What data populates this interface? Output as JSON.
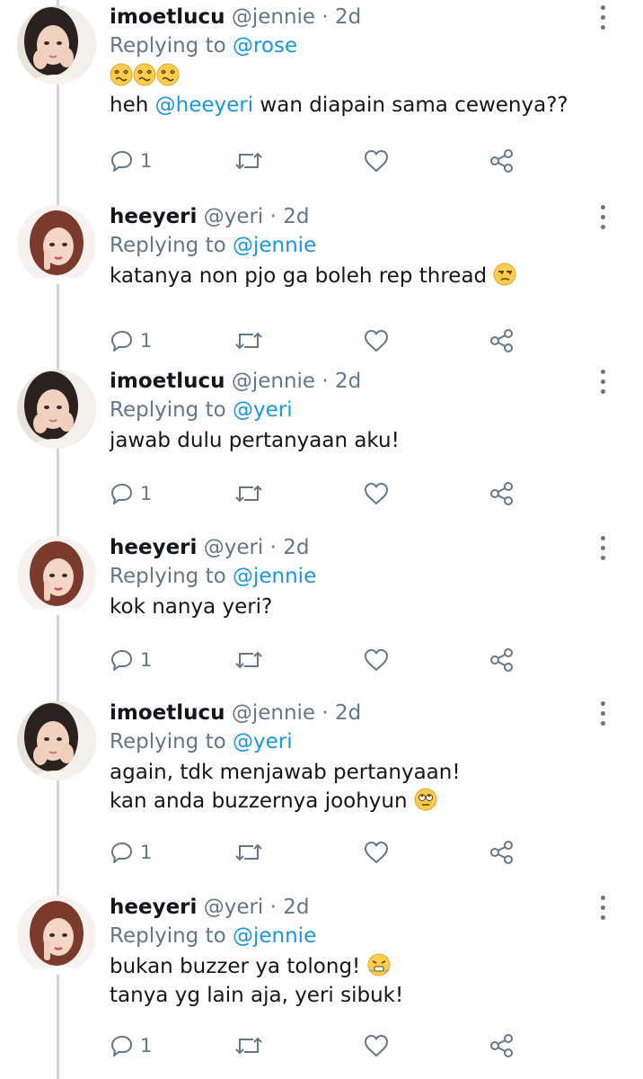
{
  "colors": {
    "mention": "#1b95e0",
    "secondary_text": "#657786",
    "thread_line": "#ccd6dd"
  },
  "tweets": [
    {
      "display_name": "imoetlucu",
      "handle": "@jennie",
      "separator": "·",
      "time": "2d",
      "replying_label": "Replying to",
      "replying_to": "@rose",
      "body": [
        {
          "emoji_only": [
            "woozy-face-emoji",
            "woozy-face-emoji",
            "woozy-face-emoji"
          ]
        },
        {
          "prefix": "heh ",
          "mention": "@heeyeri",
          "suffix": " wan diapain sama cewenya??"
        }
      ],
      "reply_count": "1",
      "avatar": "avatar-jennie"
    },
    {
      "display_name": "heeyeri",
      "handle": "@yeri",
      "separator": "·",
      "time": "2d",
      "replying_label": "Replying to",
      "replying_to": "@jennie",
      "body": [
        {
          "prefix": "katanya non pjo ga boleh rep thread ",
          "emoji": "unamused-face-emoji"
        }
      ],
      "reply_count": "1",
      "avatar": "avatar-yeri"
    },
    {
      "display_name": "imoetlucu",
      "handle": "@jennie",
      "separator": "·",
      "time": "2d",
      "replying_label": "Replying to",
      "replying_to": "@yeri",
      "body": [
        {
          "prefix": "jawab dulu pertanyaan aku!"
        }
      ],
      "reply_count": "1",
      "avatar": "avatar-jennie"
    },
    {
      "display_name": "heeyeri",
      "handle": "@yeri",
      "separator": "·",
      "time": "2d",
      "replying_label": "Replying to",
      "replying_to": "@jennie",
      "body": [
        {
          "prefix": "kok nanya yeri?"
        }
      ],
      "reply_count": "1",
      "avatar": "avatar-yeri"
    },
    {
      "display_name": "imoetlucu",
      "handle": "@jennie",
      "separator": "·",
      "time": "2d",
      "replying_label": "Replying to",
      "replying_to": "@yeri",
      "body": [
        {
          "prefix": "again, tdk menjawab pertanyaan!"
        },
        {
          "prefix": "kan anda buzzernya joohyun ",
          "emoji": "rolling-eyes-emoji"
        }
      ],
      "reply_count": "1",
      "avatar": "avatar-jennie"
    },
    {
      "display_name": "heeyeri",
      "handle": "@yeri",
      "separator": "·",
      "time": "2d",
      "replying_label": "Replying to",
      "replying_to": "@jennie",
      "body": [
        {
          "prefix": "bukan buzzer ya tolong! ",
          "emoji": "steam-from-nose-emoji"
        },
        {
          "prefix": "tanya yg lain aja, yeri sibuk!"
        }
      ],
      "reply_count": "1",
      "avatar": "avatar-yeri"
    }
  ]
}
